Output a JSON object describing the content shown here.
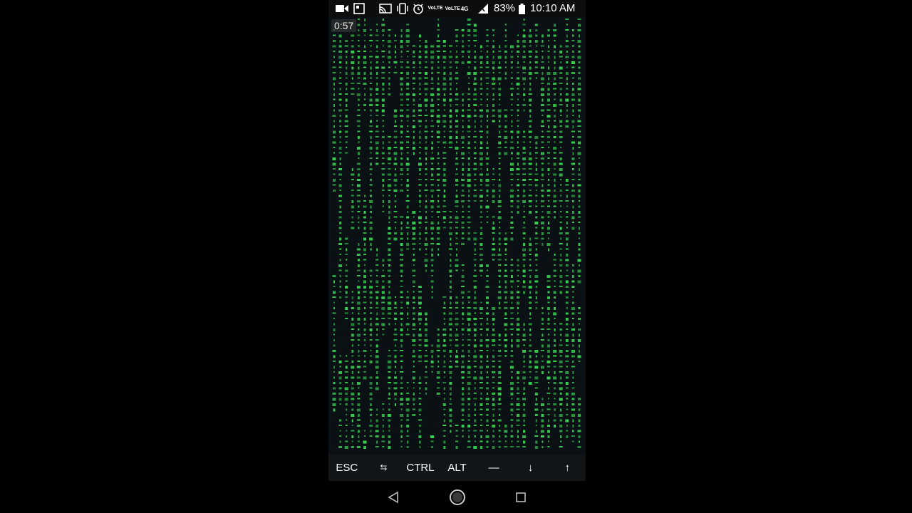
{
  "status_bar": {
    "icons": [
      "video-camera-icon",
      "image-icon",
      "cast-icon",
      "vibrate-icon",
      "alarm-icon",
      "volte-icon",
      "volte-4g-icon",
      "signal-icon",
      "battery-icon"
    ],
    "volte_1": "VoLTE",
    "volte_2": "VoLTE",
    "network": "4G",
    "battery": "83%",
    "time": "10:10 AM"
  },
  "terminal": {
    "timer": "0:57",
    "rain_color": "#39d353",
    "background": "#0a1013"
  },
  "extra_keys": [
    {
      "label": "ESC"
    },
    {
      "label": "⇆"
    },
    {
      "label": "CTRL"
    },
    {
      "label": "ALT"
    },
    {
      "label": "—"
    },
    {
      "label": "↓"
    },
    {
      "label": "↑"
    }
  ],
  "nav_bar": {
    "back": "back-icon",
    "home": "home-icon",
    "recents": "recents-icon"
  }
}
